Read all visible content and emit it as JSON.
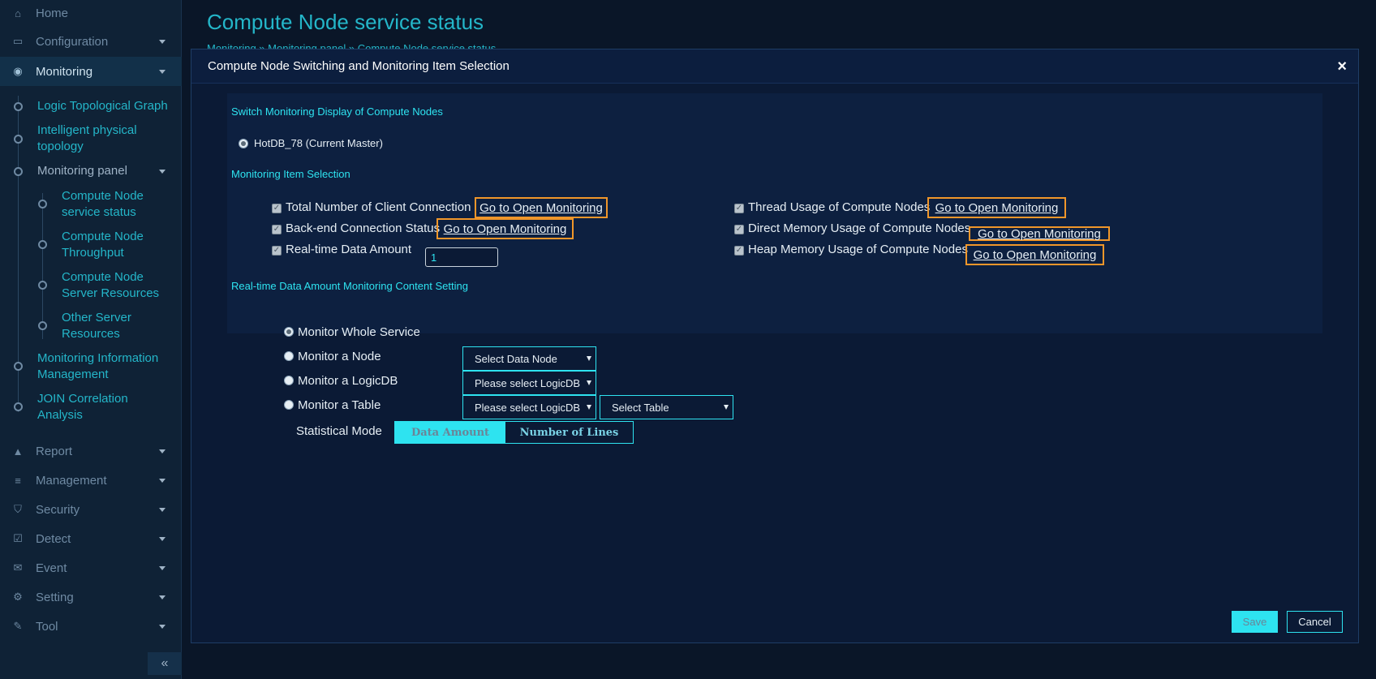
{
  "sidebar": {
    "items": [
      {
        "label": "Home",
        "icon": "home-icon"
      },
      {
        "label": "Configuration",
        "icon": "monitor-icon"
      },
      {
        "label": "Monitoring",
        "icon": "eye-icon"
      },
      {
        "label": "Report",
        "icon": "area-chart-icon"
      },
      {
        "label": "Management",
        "icon": "database-icon"
      },
      {
        "label": "Security",
        "icon": "shield-icon"
      },
      {
        "label": "Detect",
        "icon": "check-square-icon"
      },
      {
        "label": "Event",
        "icon": "envelope-icon"
      },
      {
        "label": "Setting",
        "icon": "gear-icon"
      },
      {
        "label": "Tool",
        "icon": "wrench-icon"
      }
    ],
    "monitoring_sub": [
      "Logic Topological Graph",
      "Intelligent physical topology",
      "Monitoring panel",
      "Monitoring Information Management",
      "JOIN Correlation Analysis"
    ],
    "monitoring_panel_sub": [
      "Compute Node service status",
      "Compute Node Throughput",
      "Compute Node Server Resources",
      "Other Server Resources"
    ],
    "collapse_label": "«"
  },
  "page": {
    "title": "Compute Node service status",
    "breadcrumb": "Monitoring » Monitoring panel » Compute Node service status"
  },
  "modal": {
    "title": "Compute Node Switching and Monitoring Item Selection",
    "close_label": "×",
    "switch_section_title": "Switch Monitoring Display of Compute Nodes",
    "node_option": "HotDB_78 (Current Master)",
    "monitoring_section_title": "Monitoring Item Selection",
    "items_left": [
      "Total Number of Client Connection",
      "Back-end Connection Status",
      "Real-time Data Amount"
    ],
    "items_right": [
      "Thread Usage of Compute Nodes",
      "Direct Memory Usage of Compute Nodes",
      "Heap Memory Usage of Compute Nodes"
    ],
    "open_link_label": "Go to Open Monitoring",
    "realtime_value": "1",
    "realtime_section_title": "Real-time Data Amount Monitoring Content Setting",
    "monitor_options": [
      "Monitor Whole Service",
      "Monitor a Node",
      "Monitor a LogicDB",
      "Monitor a Table"
    ],
    "select_data_node": "Select Data Node",
    "select_logicdb": "Please select LogicDB",
    "select_table": "Select Table",
    "statistical_mode_label": "Statistical Mode",
    "mode_options": [
      "Data Amount",
      "Number of Lines"
    ],
    "save_label": "Save",
    "cancel_label": "Cancel"
  }
}
